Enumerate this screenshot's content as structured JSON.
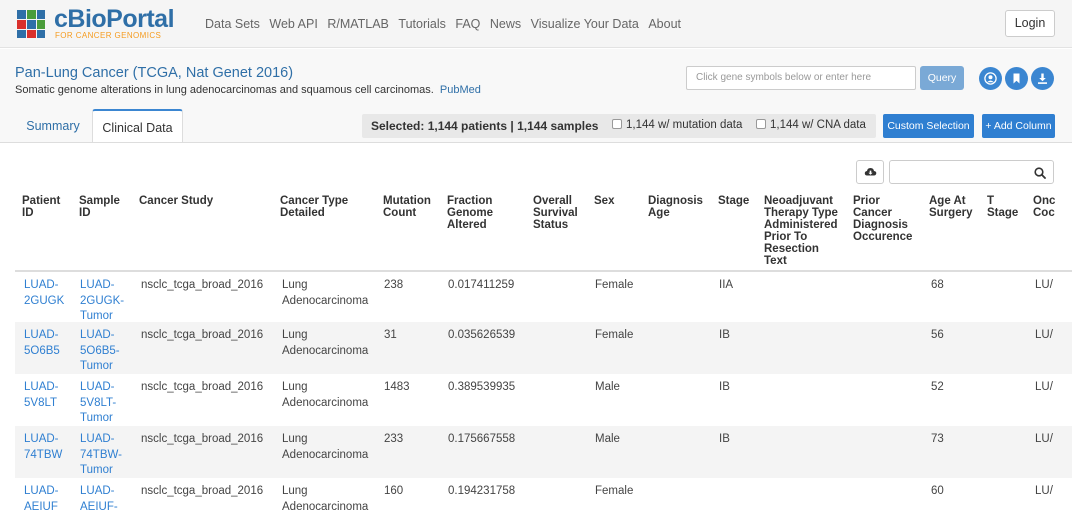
{
  "brand": {
    "title": "cBioPortal",
    "subtitle": "FOR CANCER GENOMICS",
    "colors": {
      "blue": "#2f6fa7",
      "orange": "#f59c21",
      "red": "#d9302c",
      "green": "#4a9c3b"
    }
  },
  "nav": {
    "links": [
      "Data Sets",
      "Web API",
      "R/MATLAB",
      "Tutorials",
      "FAQ",
      "News",
      "Visualize Your Data",
      "About"
    ],
    "login_label": "Login"
  },
  "study": {
    "title": "Pan-Lung Cancer (TCGA, Nat Genet 2016)",
    "description": "Somatic genome alterations in lung adenocarcinomas and squamous cell carcinomas.",
    "pubmed_label": "PubMed",
    "gene_placeholder": "Click gene symbols below or enter here",
    "query_label": "Query",
    "icons": [
      "user-circle-icon",
      "bookmark-icon",
      "download-icon"
    ]
  },
  "tabs": {
    "summary": "Summary",
    "clinical": "Clinical Data"
  },
  "selection": {
    "summary": "Selected: 1,144 patients | 1,144 samples",
    "mutation_filter": "1,144 w/ mutation data",
    "cna_filter": "1,144 w/ CNA data",
    "custom_selection": "Custom Selection",
    "add_column": "+ Add Column"
  },
  "table": {
    "headers": [
      [
        "Patient",
        "ID"
      ],
      [
        "Sample",
        "ID"
      ],
      [
        "Cancer Study"
      ],
      [
        "Cancer Type",
        "Detailed"
      ],
      [
        "Mutation",
        "Count"
      ],
      [
        "Fraction",
        "Genome",
        "Altered"
      ],
      [
        "Overall",
        "Survival",
        "Status"
      ],
      [
        "Sex"
      ],
      [
        "Diagnosis",
        "Age"
      ],
      [
        "Stage"
      ],
      [
        "Neoadjuvant",
        "Therapy Type",
        "Administered",
        "Prior To",
        "Resection",
        "Text"
      ],
      [
        "Prior",
        "Cancer",
        "Diagnosis",
        "Occurence"
      ],
      [
        "Age At",
        "Surgery"
      ],
      [
        "T",
        "Stage"
      ],
      [
        "Onc",
        "Coc"
      ]
    ],
    "rows": [
      {
        "patient": [
          "LUAD-",
          "2GUGK"
        ],
        "sample": [
          "LUAD-",
          "2GUGK-",
          "Tumor"
        ],
        "study": "nsclc_tcga_broad_2016",
        "cancer_type": [
          "Lung",
          "Adenocarcinoma"
        ],
        "mutation_count": "238",
        "fga": "0.017411259",
        "sex": "Female",
        "stage": "IIA",
        "age": "68",
        "onc": "LU/"
      },
      {
        "patient": [
          "LUAD-",
          "5O6B5"
        ],
        "sample": [
          "LUAD-",
          "5O6B5-",
          "Tumor"
        ],
        "study": "nsclc_tcga_broad_2016",
        "cancer_type": [
          "Lung",
          "Adenocarcinoma"
        ],
        "mutation_count": "31",
        "fga": "0.035626539",
        "sex": "Female",
        "stage": "IB",
        "age": "56",
        "onc": "LU/"
      },
      {
        "patient": [
          "LUAD-",
          "5V8LT"
        ],
        "sample": [
          "LUAD-",
          "5V8LT-",
          "Tumor"
        ],
        "study": "nsclc_tcga_broad_2016",
        "cancer_type": [
          "Lung",
          "Adenocarcinoma"
        ],
        "mutation_count": "1483",
        "fga": "0.389539935",
        "sex": "Male",
        "stage": "IB",
        "age": "52",
        "onc": "LU/"
      },
      {
        "patient": [
          "LUAD-",
          "74TBW"
        ],
        "sample": [
          "LUAD-",
          "74TBW-",
          "Tumor"
        ],
        "study": "nsclc_tcga_broad_2016",
        "cancer_type": [
          "Lung",
          "Adenocarcinoma"
        ],
        "mutation_count": "233",
        "fga": "0.175667558",
        "sex": "Male",
        "stage": "IB",
        "age": "73",
        "onc": "LU/"
      },
      {
        "patient": [
          "LUAD-",
          "AEIUF"
        ],
        "sample": [
          "LUAD-",
          "AEIUF-",
          "Tumor"
        ],
        "study": "nsclc_tcga_broad_2016",
        "cancer_type": [
          "Lung",
          "Adenocarcinoma"
        ],
        "mutation_count": "160",
        "fga": "0.194231758",
        "sex": "Female",
        "stage": "",
        "age": "60",
        "onc": "LU/"
      }
    ]
  }
}
